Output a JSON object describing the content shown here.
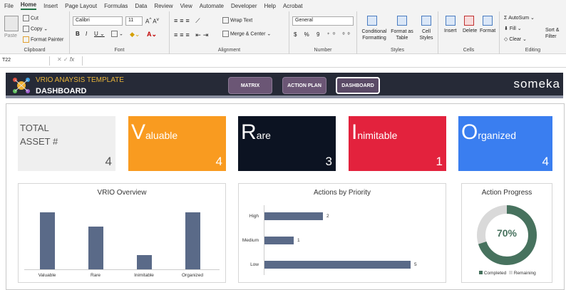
{
  "menu": [
    "File",
    "Home",
    "Insert",
    "Page Layout",
    "Formulas",
    "Data",
    "Review",
    "View",
    "Automate",
    "Developer",
    "Help",
    "Acrobat"
  ],
  "ribbon": {
    "clipboard": {
      "paste": "Paste",
      "cut": "Cut",
      "copy": "Copy",
      "format_painter": "Format Painter",
      "label": "Clipboard"
    },
    "font": {
      "name": "Calibri",
      "size": "11",
      "label": "Font"
    },
    "alignment": {
      "wrap": "Wrap Text",
      "merge": "Merge & Center",
      "label": "Alignment"
    },
    "number": {
      "format": "General",
      "label": "Number"
    },
    "styles": {
      "conditional": "Conditional Formatting",
      "format_table": "Format as Table",
      "cell_styles": "Cell Styles",
      "label": "Styles"
    },
    "cells": {
      "insert": "Insert",
      "delete": "Delete",
      "format": "Format",
      "label": "Cells"
    },
    "editing": {
      "autosum": "AutoSum",
      "fill": "Fill",
      "clear": "Clear",
      "sort": "Sort & Filter",
      "label": "Editing"
    }
  },
  "formula_bar": {
    "name_box": "T22",
    "fx": "fx",
    "value": ""
  },
  "header": {
    "template": "VRIO ANAYSIS TEMPLATE",
    "title": "DASHBOARD",
    "brand": "someka",
    "nav": [
      {
        "label": "MATRIX"
      },
      {
        "label": "ACTION PLAN"
      },
      {
        "label": "DASHBOARD"
      }
    ]
  },
  "kpis": {
    "total": {
      "line1": "TOTAL",
      "line2": "ASSET #",
      "value": "4"
    },
    "valuable": {
      "initial": "V",
      "rest": "aluable",
      "value": "4",
      "color": "#f99b20"
    },
    "rare": {
      "initial": "R",
      "rest": "are",
      "value": "3",
      "color": "#0c1322"
    },
    "inimitable": {
      "initial": "I",
      "rest": "nimitable",
      "value": "1",
      "color": "#e3223d"
    },
    "organized": {
      "initial": "O",
      "rest": "rganized",
      "value": "4",
      "color": "#3a7ef0"
    }
  },
  "charts": {
    "overview_title": "VRIO Overview",
    "priority_title": "Actions by Priority",
    "progress_title": "Action Progress",
    "progress_pct": "70%",
    "legend_completed": "Completed",
    "legend_remaining": "Remaining"
  },
  "chart_data": [
    {
      "type": "bar",
      "title": "VRIO Overview",
      "categories": [
        "Valuable",
        "Rare",
        "Inimitable",
        "Organized"
      ],
      "values": [
        4,
        3,
        1,
        4
      ],
      "color": "#5a6a88"
    },
    {
      "type": "bar",
      "orientation": "horizontal",
      "title": "Actions by Priority",
      "categories": [
        "High",
        "Medium",
        "Low"
      ],
      "values": [
        2,
        1,
        5
      ],
      "color": "#5a6a88"
    },
    {
      "type": "pie",
      "style": "donut",
      "title": "Action Progress",
      "slices": [
        {
          "name": "Completed",
          "value": 70,
          "color": "#47725e"
        },
        {
          "name": "Remaining",
          "value": 30,
          "color": "#d9d9d9"
        }
      ]
    }
  ]
}
